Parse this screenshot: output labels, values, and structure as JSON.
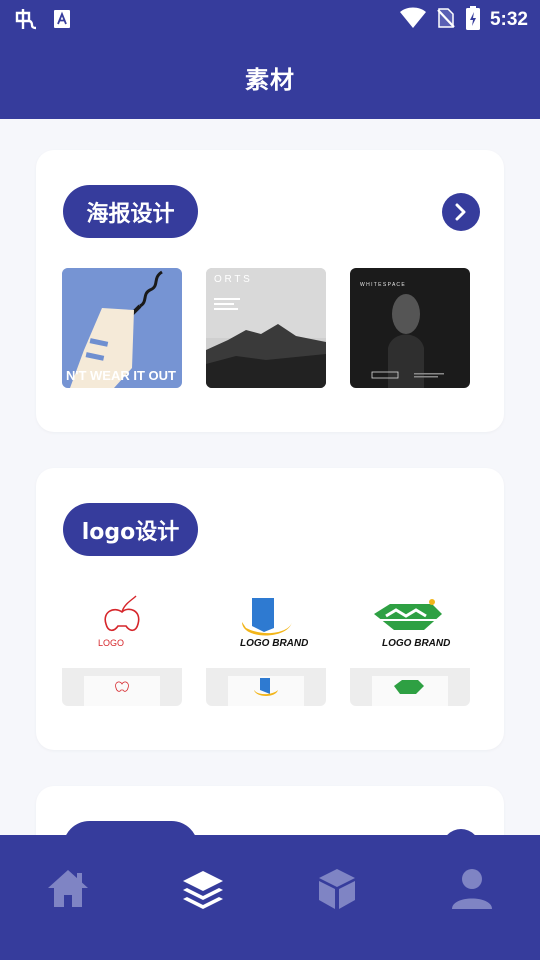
{
  "status_bar": {
    "time": "5:32",
    "icons": [
      "bug-icon",
      "a-box-icon",
      "wifi-icon",
      "no-sim-icon",
      "battery-charging-icon"
    ]
  },
  "header": {
    "title": "素材"
  },
  "sections": [
    {
      "title": "海报设计",
      "has_more_button": true,
      "thumbnails": [
        {
          "caption": "N'T WEAR IT OUT",
          "alt": "poster-plug"
        },
        {
          "caption": "O R T S",
          "alt": "poster-sports-mountain"
        },
        {
          "caption": "W H I T E S P A C E",
          "alt": "poster-whitespace"
        }
      ]
    },
    {
      "title": "logo设计",
      "has_more_button": false,
      "thumbnails": [
        {
          "caption": "LOGO",
          "alt": "logo-gamepad"
        },
        {
          "caption": "LOGO BRAND",
          "alt": "logo-blue-building"
        },
        {
          "caption": "LOGO BRAND",
          "alt": "logo-green-house"
        }
      ]
    },
    {
      "title": "",
      "has_more_button": true,
      "thumbnails": []
    }
  ],
  "tabbar": {
    "active_index": 1,
    "tabs": [
      {
        "icon": "home-icon",
        "label": "首页"
      },
      {
        "icon": "layers-icon",
        "label": "素材"
      },
      {
        "icon": "cube-icon",
        "label": "模型"
      },
      {
        "icon": "user-icon",
        "label": "我的"
      }
    ]
  },
  "colors": {
    "primary": "#363c9c",
    "background": "#f6f7fb",
    "card": "#ffffff",
    "inactive_icon": "#7f84c4"
  }
}
